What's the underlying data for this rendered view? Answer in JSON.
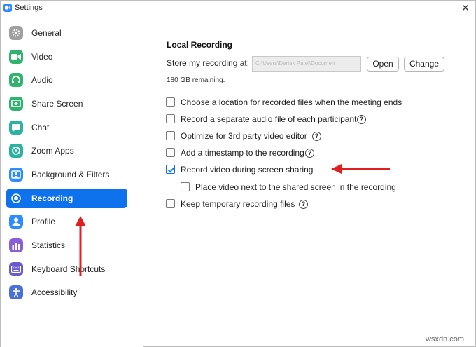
{
  "window": {
    "title": "Settings",
    "close_glyph": "✕"
  },
  "sidebar": {
    "items": [
      {
        "label": "General",
        "icon": "gear-icon",
        "color": "#a0a0a0",
        "active": false
      },
      {
        "label": "Video",
        "icon": "video-icon",
        "color": "#2fb36d",
        "active": false
      },
      {
        "label": "Audio",
        "icon": "headphones-icon",
        "color": "#2fb36d",
        "active": false
      },
      {
        "label": "Share Screen",
        "icon": "share-screen-icon",
        "color": "#2fb36d",
        "active": false
      },
      {
        "label": "Chat",
        "icon": "chat-icon",
        "color": "#29b3a0",
        "active": false
      },
      {
        "label": "Zoom Apps",
        "icon": "apps-icon",
        "color": "#29b3a0",
        "active": false
      },
      {
        "label": "Background & Filters",
        "icon": "background-icon",
        "color": "#2d8cff",
        "active": false
      },
      {
        "label": "Recording",
        "icon": "record-icon",
        "color": "#0e72ed",
        "active": true
      },
      {
        "label": "Profile",
        "icon": "profile-icon",
        "color": "#2d8cff",
        "active": false
      },
      {
        "label": "Statistics",
        "icon": "statistics-icon",
        "color": "#8a5cd8",
        "active": false
      },
      {
        "label": "Keyboard Shortcuts",
        "icon": "keyboard-icon",
        "color": "#6a5acd",
        "active": false
      },
      {
        "label": "Accessibility",
        "icon": "accessibility-icon",
        "color": "#4a6fd8",
        "active": false
      }
    ]
  },
  "recording": {
    "section_title": "Local Recording",
    "store_label": "Store my recording at:",
    "path_value": "C:\\Users\\Dariak Patel\\Documen",
    "open_label": "Open",
    "change_label": "Change",
    "remaining": "180 GB remaining.",
    "options": [
      {
        "label": "Choose a location for recorded files when the meeting ends",
        "checked": false,
        "help": false
      },
      {
        "label": "Record a separate audio file of each participant",
        "checked": false,
        "help": true
      },
      {
        "label": "Optimize for 3rd party video editor",
        "checked": false,
        "help": true
      },
      {
        "label": "Add a timestamp to the recording",
        "checked": false,
        "help": true
      },
      {
        "label": "Record video during screen sharing",
        "checked": true,
        "help": false
      },
      {
        "label": "Place video next to the shared screen in the recording",
        "checked": false,
        "help": false
      },
      {
        "label": "Keep temporary recording files",
        "checked": false,
        "help": true
      }
    ]
  },
  "colors": {
    "accent": "#0e72ed",
    "annotation_arrow": "#e02020"
  },
  "watermark": "wsxdn.com"
}
